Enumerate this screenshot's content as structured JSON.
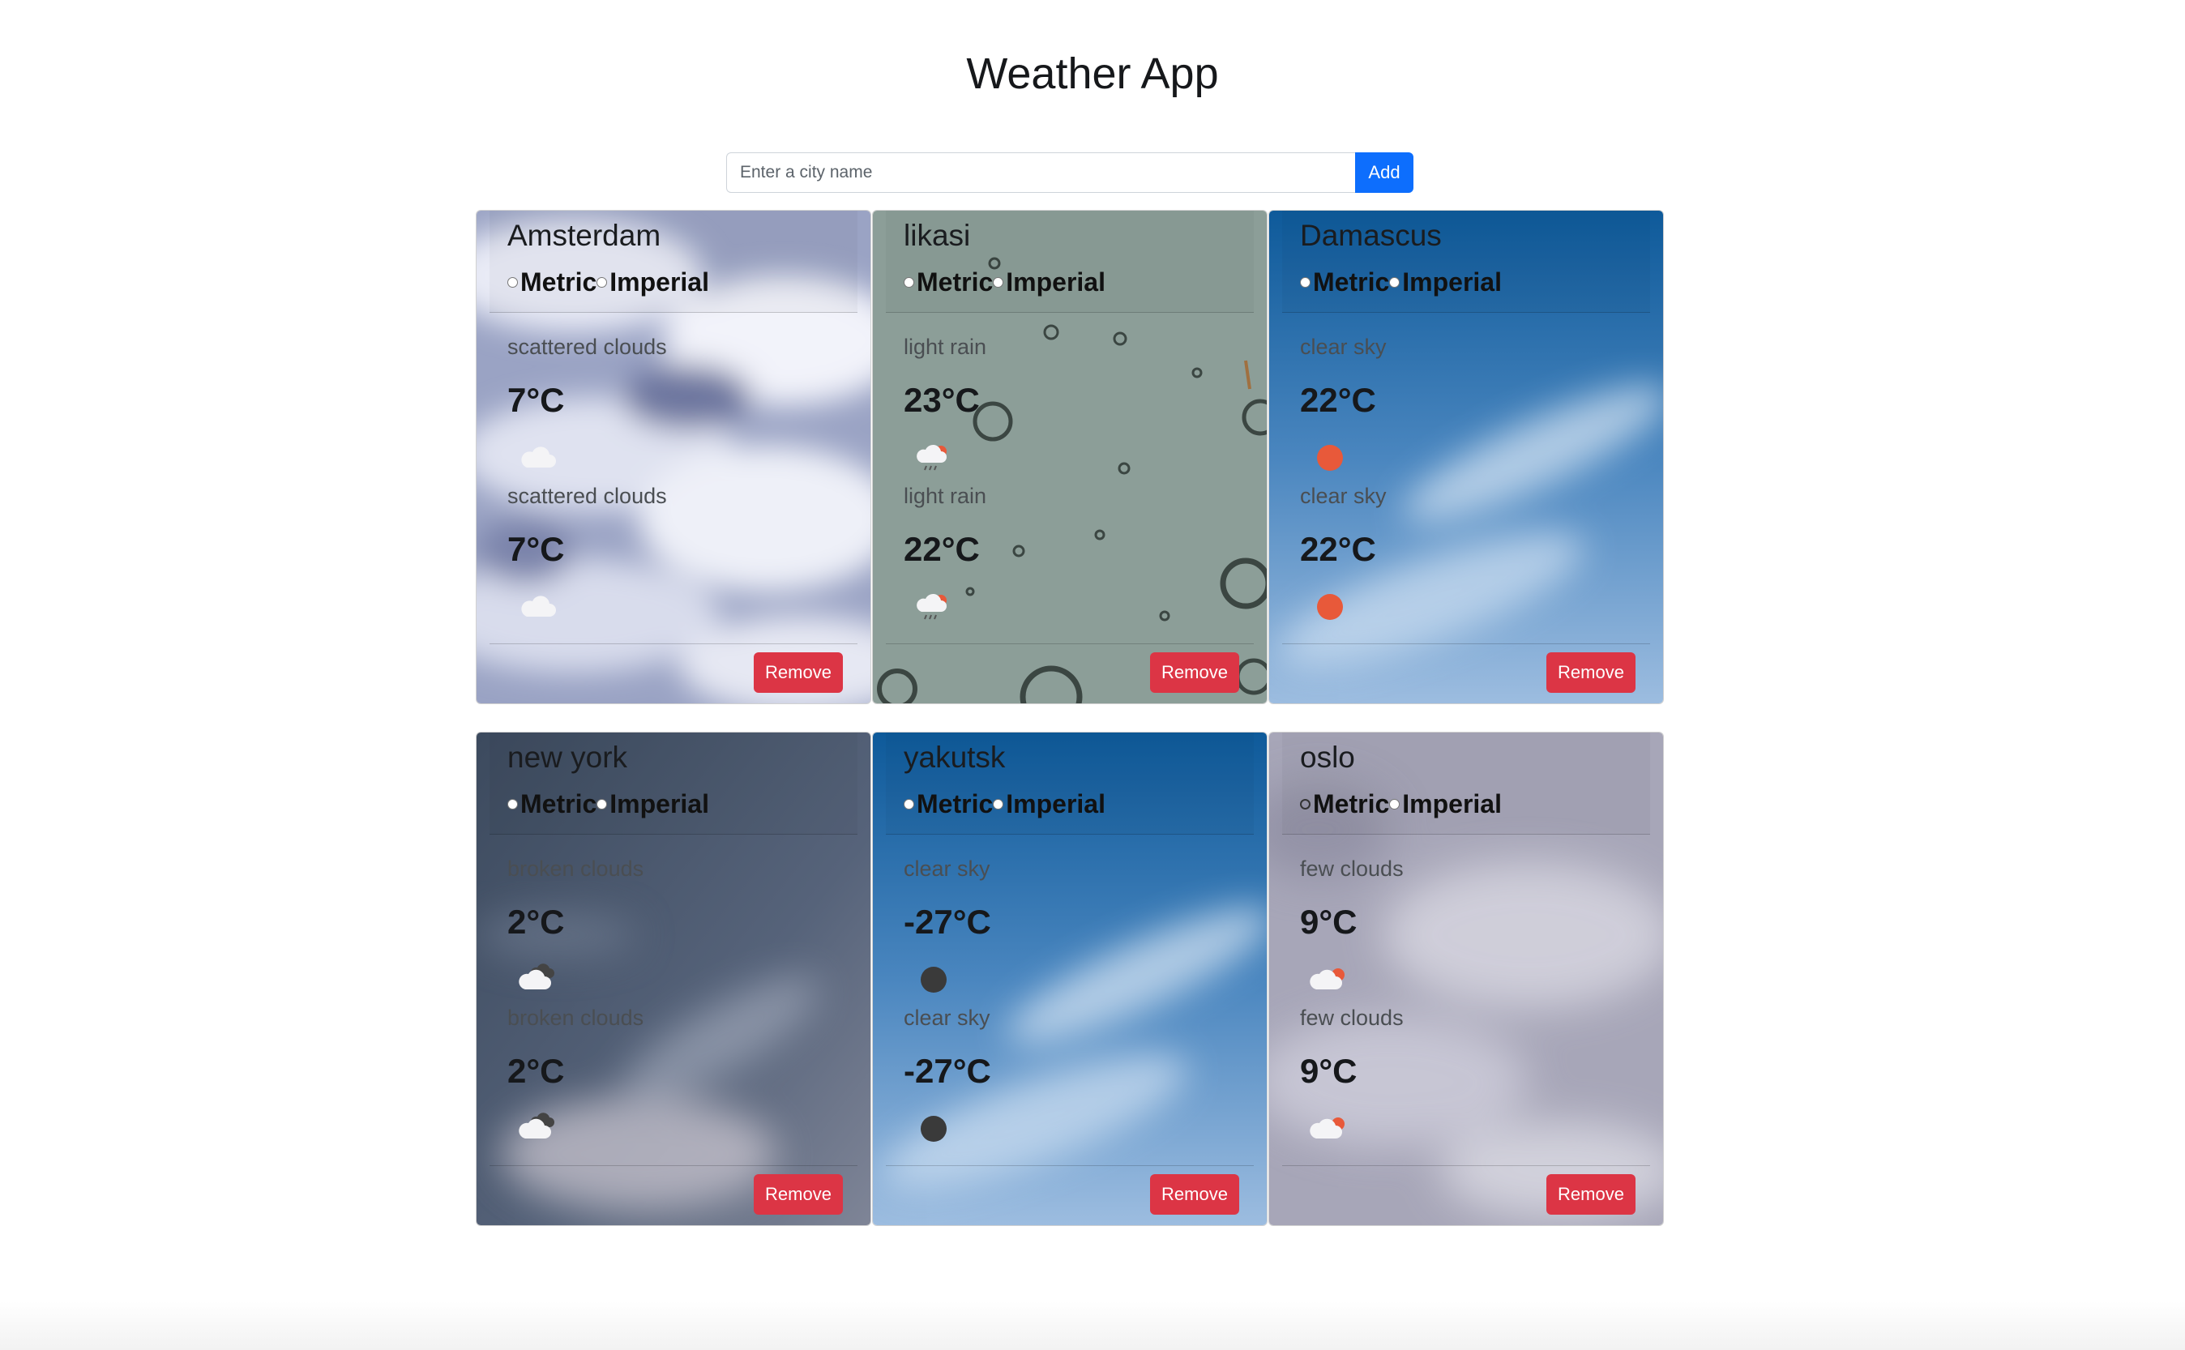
{
  "app": {
    "title": "Weather App"
  },
  "search": {
    "placeholder": "Enter a city name",
    "value": "",
    "add_label": "Add"
  },
  "units": {
    "metric": "Metric",
    "imperial": "Imperial"
  },
  "remove_label": "Remove",
  "cards": [
    {
      "city": "Amsterdam",
      "selected_unit": "metric",
      "forecasts": [
        {
          "description": "scattered clouds",
          "temperature": "7°C",
          "icon": "cloud-icon"
        },
        {
          "description": "scattered clouds",
          "temperature": "7°C",
          "icon": "cloud-icon"
        }
      ]
    },
    {
      "city": "likasi",
      "selected_unit": "metric",
      "forecasts": [
        {
          "description": "light rain",
          "temperature": "23°C",
          "icon": "sun-rain-cloud-icon"
        },
        {
          "description": "light rain",
          "temperature": "22°C",
          "icon": "sun-rain-cloud-icon"
        }
      ]
    },
    {
      "city": "Damascus",
      "selected_unit": "metric",
      "forecasts": [
        {
          "description": "clear sky",
          "temperature": "22°C",
          "icon": "sun-icon"
        },
        {
          "description": "clear sky",
          "temperature": "22°C",
          "icon": "sun-icon"
        }
      ]
    },
    {
      "city": "new york",
      "selected_unit": "metric",
      "forecasts": [
        {
          "description": "broken clouds",
          "temperature": "2°C",
          "icon": "broken-clouds-icon"
        },
        {
          "description": "broken clouds",
          "temperature": "2°C",
          "icon": "broken-clouds-icon"
        }
      ]
    },
    {
      "city": "yakutsk",
      "selected_unit": "metric",
      "forecasts": [
        {
          "description": "clear sky",
          "temperature": "-27°C",
          "icon": "moon-icon"
        },
        {
          "description": "clear sky",
          "temperature": "-27°C",
          "icon": "moon-icon"
        }
      ]
    },
    {
      "city": "oslo",
      "selected_unit": "imperial",
      "forecasts": [
        {
          "description": "few clouds",
          "temperature": "9°C",
          "icon": "few-clouds-icon"
        },
        {
          "description": "few clouds",
          "temperature": "9°C",
          "icon": "few-clouds-icon"
        }
      ]
    }
  ],
  "colors": {
    "add_button": "#0d6efd",
    "remove_button": "#dc3545",
    "sun": "#e8593a",
    "moon": "#3a3a3a"
  }
}
